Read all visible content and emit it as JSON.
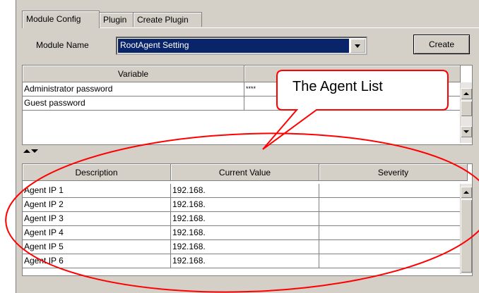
{
  "tabs": [
    {
      "label": "Module Config",
      "active": true
    },
    {
      "label": "Plugin",
      "active": false
    },
    {
      "label": "Create Plugin",
      "active": false
    }
  ],
  "module": {
    "label": "Module Name",
    "selected": "RootAgent Setting",
    "create_button": "Create"
  },
  "variables": {
    "headers": [
      "Variable",
      ""
    ],
    "rows": [
      {
        "name": "Administrator password",
        "value": "****"
      },
      {
        "name": "Guest password",
        "value": ""
      }
    ]
  },
  "agents": {
    "headers": [
      "Description",
      "Current Value",
      "Severity"
    ],
    "rows": [
      {
        "description": "Agent IP 1",
        "value": "192.168.",
        "severity": ""
      },
      {
        "description": "Agent IP 2",
        "value": "192.168.",
        "severity": ""
      },
      {
        "description": "Agent IP 3",
        "value": "192.168.",
        "severity": ""
      },
      {
        "description": "Agent IP 4",
        "value": "192.168.",
        "severity": ""
      },
      {
        "description": "Agent IP 5",
        "value": "192.168.",
        "severity": ""
      },
      {
        "description": "Agent IP 6",
        "value": "192.168.",
        "severity": ""
      }
    ]
  },
  "annotation": {
    "callout_text": "The Agent List",
    "color": "#ff0000"
  }
}
